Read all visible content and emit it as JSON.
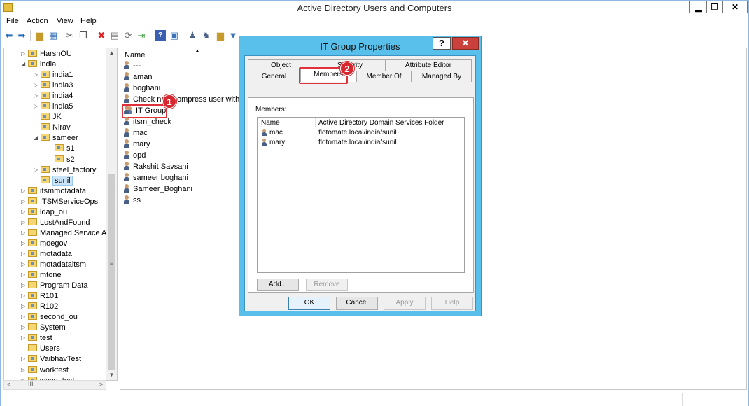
{
  "window": {
    "title": "Active Directory Users and Computers",
    "min_glyph": "▁",
    "max_glyph": "❐",
    "close_glyph": "✕"
  },
  "menu": [
    "File",
    "Action",
    "View",
    "Help"
  ],
  "tree": {
    "items": [
      {
        "label": "HarshOU",
        "exp": "▷"
      },
      {
        "label": "india",
        "exp": "◢"
      },
      {
        "label": "india1",
        "exp": "▷"
      },
      {
        "label": "india3",
        "exp": "▷"
      },
      {
        "label": "india4",
        "exp": "▷"
      },
      {
        "label": "india5",
        "exp": "▷"
      },
      {
        "label": "JK",
        "exp": ""
      },
      {
        "label": "Nirav",
        "exp": ""
      },
      {
        "label": "sameer",
        "exp": "◢"
      },
      {
        "label": "s1",
        "exp": ""
      },
      {
        "label": "s2",
        "exp": ""
      },
      {
        "label": "steel_factory",
        "exp": "▷"
      },
      {
        "label": "sunil",
        "exp": ""
      },
      {
        "label": "itsmmotadata",
        "exp": "▷"
      },
      {
        "label": "ITSMServiceOps",
        "exp": "▷"
      },
      {
        "label": "ldap_ou",
        "exp": "▷"
      },
      {
        "label": "LostAndFound",
        "exp": "▷"
      },
      {
        "label": "Managed Service Acc",
        "exp": "▷"
      },
      {
        "label": "moegov",
        "exp": "▷"
      },
      {
        "label": "motadata",
        "exp": "▷"
      },
      {
        "label": "motadataitsm",
        "exp": "▷"
      },
      {
        "label": "mtone",
        "exp": "▷"
      },
      {
        "label": "Program Data",
        "exp": "▷"
      },
      {
        "label": "R101",
        "exp": "▷"
      },
      {
        "label": "R102",
        "exp": "▷"
      },
      {
        "label": "second_ou",
        "exp": "▷"
      },
      {
        "label": "System",
        "exp": "▷"
      },
      {
        "label": "test",
        "exp": "▷"
      },
      {
        "label": "Users",
        "exp": ""
      },
      {
        "label": "VaibhavTest",
        "exp": "▷"
      },
      {
        "label": "worktest",
        "exp": "▷"
      },
      {
        "label": "wave_test",
        "exp": "▷"
      }
    ],
    "scroll_up": "▲",
    "scroll_down": "▼",
    "grip": "≡",
    "h_left": "<",
    "h_thumb": "III",
    "h_right": ">"
  },
  "list": {
    "column_name": "Name",
    "sort_glyph": "▲",
    "rows": [
      "---",
      "aman",
      "boghani",
      "Check new compress user with zip",
      "IT Group",
      "itsm_check",
      "mac",
      "mary",
      "opd",
      "Rakshit Savsani",
      "sameer boghani",
      "Sameer_Boghani",
      "ss"
    ]
  },
  "annotations": {
    "step1": "1",
    "step2": "2"
  },
  "dialog": {
    "title": "IT Group Properties",
    "help": "?",
    "close": "✕",
    "tabs_row1": [
      "Object",
      "Security",
      "Attribute Editor"
    ],
    "tabs_row2": [
      "General",
      "Members",
      "Member Of",
      "Managed By"
    ],
    "members_label": "Members:",
    "columns": [
      "Name",
      "Active Directory Domain Services Folder"
    ],
    "members": [
      {
        "name": "mac",
        "folder": "flotomate.local/india/sunil"
      },
      {
        "name": "mary",
        "folder": "flotomate.local/india/sunil"
      }
    ],
    "add_button": "Add...",
    "remove_button": "Remove",
    "ok_button": "OK",
    "cancel_button": "Cancel",
    "apply_button": "Apply",
    "help_button": "Help"
  },
  "toolbar_icons": [
    "back-icon",
    "forward-icon",
    "up-folder-icon",
    "console-tree-icon",
    "cut-icon",
    "copy-icon",
    "delete-icon",
    "properties-icon",
    "refresh-icon",
    "export-icon",
    "help-icon",
    "view-icon",
    "add-user-icon",
    "add-group-icon",
    "add-ou-icon",
    "filter-icon",
    "add-to-group-icon"
  ]
}
